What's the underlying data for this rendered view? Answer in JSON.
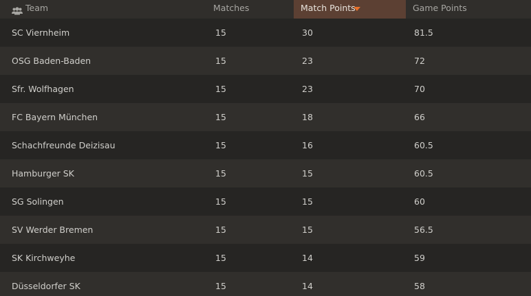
{
  "header": {
    "team_label": "Team",
    "matches_label": "Matches",
    "match_points_label": "Match Points",
    "game_points_label": "Game Points",
    "team_icon": "users-icon",
    "sort_icon": "sort-desc-arrow-icon",
    "sort_active_color": "#5c4033",
    "accent_color": "#e8702a"
  },
  "rows": [
    {
      "team": "SC Viernheim",
      "matches": "15",
      "match_points": "30",
      "game_points": "81.5"
    },
    {
      "team": "OSG Baden-Baden",
      "matches": "15",
      "match_points": "23",
      "game_points": "72"
    },
    {
      "team": "Sfr. Wolfhagen",
      "matches": "15",
      "match_points": "23",
      "game_points": "70"
    },
    {
      "team": "FC Bayern München",
      "matches": "15",
      "match_points": "18",
      "game_points": "66"
    },
    {
      "team": "Schachfreunde Deizisau",
      "matches": "15",
      "match_points": "16",
      "game_points": "60.5"
    },
    {
      "team": "Hamburger SK",
      "matches": "15",
      "match_points": "15",
      "game_points": "60.5"
    },
    {
      "team": "SG Solingen",
      "matches": "15",
      "match_points": "15",
      "game_points": "60"
    },
    {
      "team": "SV Werder Bremen",
      "matches": "15",
      "match_points": "15",
      "game_points": "56.5"
    },
    {
      "team": "SK Kirchweyhe",
      "matches": "15",
      "match_points": "14",
      "game_points": "59"
    },
    {
      "team": "Düsseldorfer SK",
      "matches": "15",
      "match_points": "14",
      "game_points": "58"
    }
  ]
}
